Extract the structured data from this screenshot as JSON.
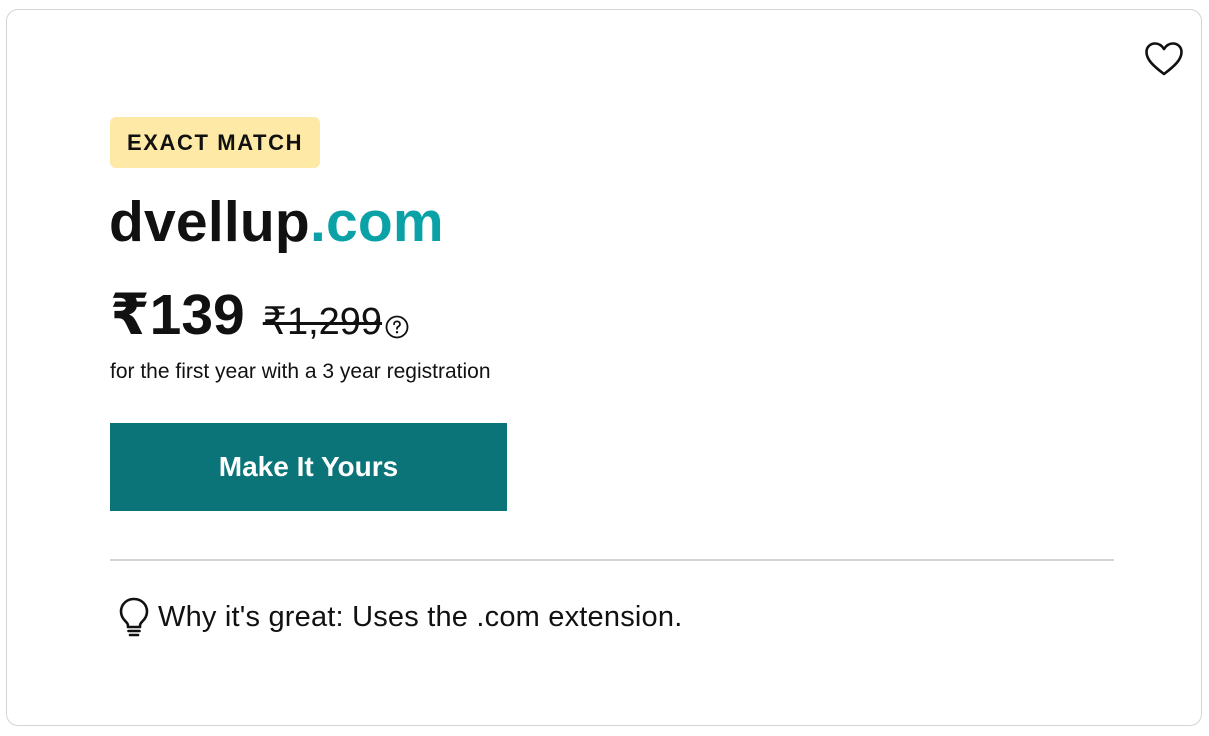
{
  "card": {
    "badge": "EXACT MATCH",
    "domain": {
      "sld": "dvellup",
      "tld": ".com"
    },
    "price": {
      "current": "₹139",
      "original": "₹1,299"
    },
    "term": "for the first year with a 3 year registration",
    "cta_label": "Make It Yours",
    "why": "Why it's great: Uses the .com extension."
  },
  "icons": {
    "favorite": "heart-icon",
    "help": "question-circle-icon",
    "tip": "lightbulb-icon"
  },
  "colors": {
    "tld": "#0aa2a6",
    "cta_background": "#0a7478",
    "badge_background": "#ffe9a6",
    "border": "#d4d4d4"
  }
}
